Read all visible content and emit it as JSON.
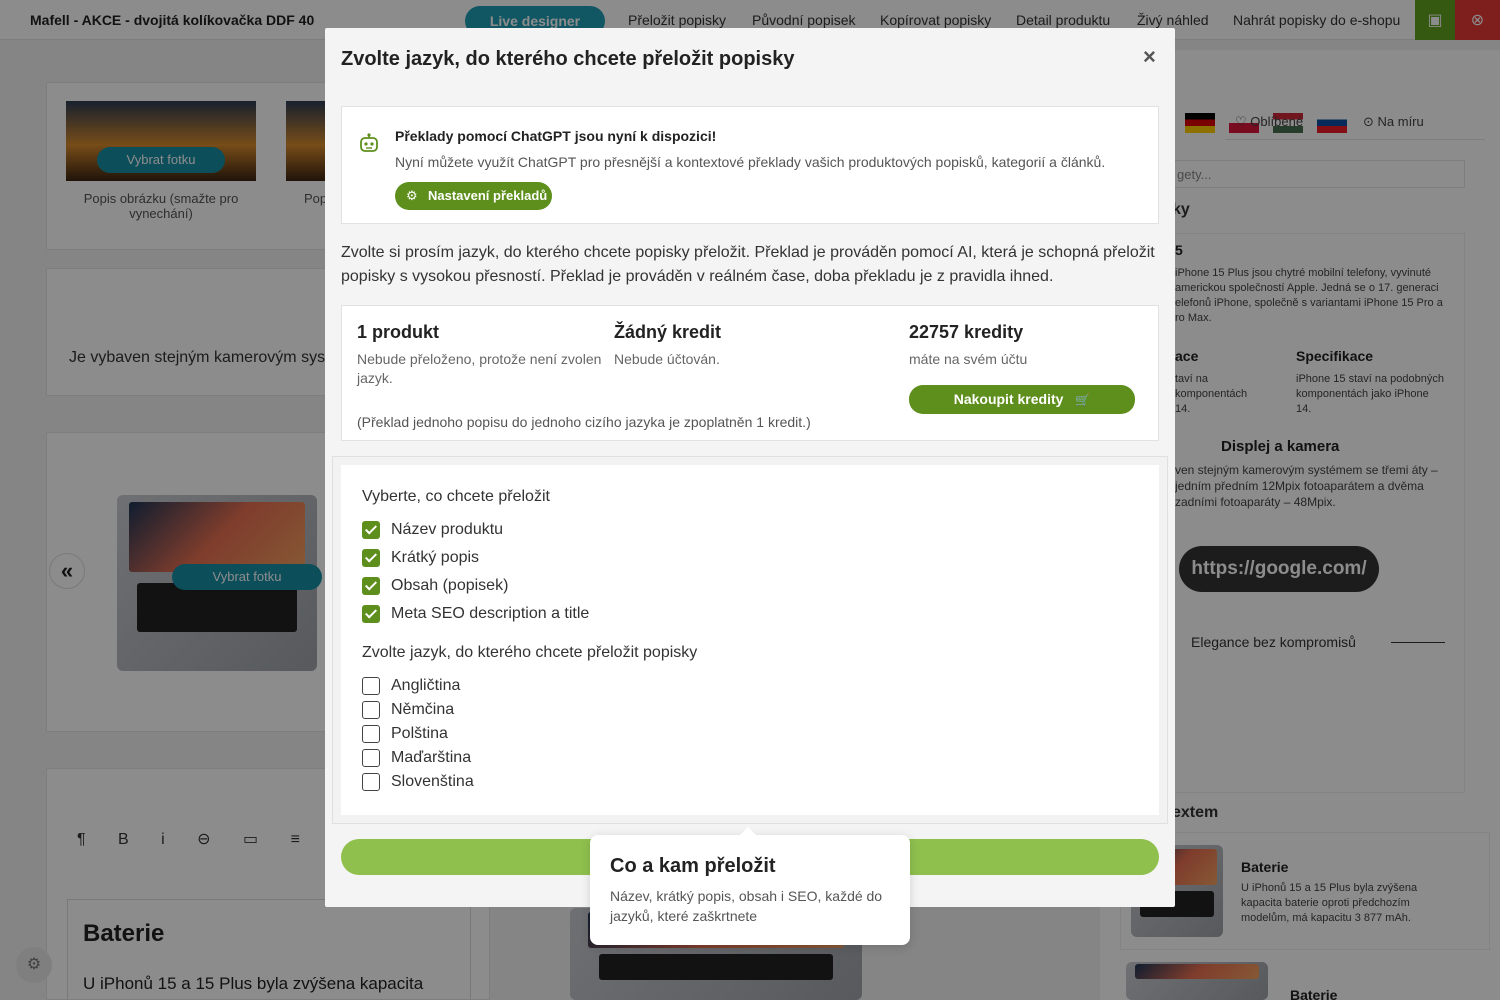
{
  "app": {
    "title": "Mafell - AKCE - dvojitá kolíkovačka DDF 40",
    "live_designer": "Live designer",
    "nav": [
      "Přeložit popisky",
      "Původní popisek",
      "Kopírovat popisky",
      "Detail produktu",
      "Živý náhled",
      "Nahrát popisky do e-shopu"
    ]
  },
  "background": {
    "pick_photo": "Vybrat fotku",
    "image_caption": "Popis obrázku (smažte pro vynechání)",
    "image_caption_cut": "Pop",
    "camera_text": "Je vybaven stejným kamerovým syste",
    "editor_heading": "Baterie",
    "editor_text": "U iPhonů 15 a 15 Plus byla zvýšena kapacita",
    "tabs": [
      "Oblíbené",
      "Na míru"
    ],
    "search_placeholder": "gety...",
    "section_short": "ky",
    "product_num": "5",
    "product_desc": "iPhone 15 Plus jsou chytré mobilní telefony, vyvinuté americkou společností Apple. Jedná se o 17. generaci elefonů iPhone, společně s variantami iPhone 15 Pro a ro Max.",
    "col1_h": "ace",
    "col1_p": "taví na komponentách 14.",
    "col2_h": "Specifikace",
    "col2_p": "iPhone 15 staví na podobných komponentách jako iPhone 14.",
    "display_h": "Displej a kamera",
    "display_p": "ven stejným kamerovým systémem se třemi áty – jedním předním 12Mpix fotoaparátem a dvěma zadními fotoaparáty – 48Mpix.",
    "link_btn": "https://google.com/",
    "elegance": "Elegance bez kompromisů",
    "with_text": "extem",
    "battery_h": "Baterie",
    "battery_p": "U iPhonů 15 a 15 Plus byla zvýšena kapacita baterie oproti předchozím modelům, má kapacitu 3 877 mAh.",
    "battery_h2": "Baterie"
  },
  "modal": {
    "title": "Zvolte jazyk, do kterého chcete přeložit popisky",
    "close": "×",
    "info": {
      "heading": "Překlady pomocí ChatGPT jsou nyní k dispozici!",
      "text": "Nyní můžete využít ChatGPT pro přesnější a kontextové překlady vašich produktových popisků, kategorií a článků.",
      "button": "Nastavení překladů"
    },
    "intro": "Zvolte si prosím jazyk, do kterého chcete popisky přeložit. Překlad je prováděn pomocí AI, která je schopná přeložit popisky s vysokou přesností. Překlad je prováděn v reálném čase, doba překladu je z pravidla ihned.",
    "stats": {
      "products_h": "1 produkt",
      "products_s": "Nebude přeloženo, protože není zvolen jazyk.",
      "credit_h": "Žádný kredit",
      "credit_s": "Nebude účtován.",
      "balance_h": "22757 kredity",
      "balance_s": "máte na svém účtu",
      "buy": "Nakoupit kredity",
      "note": "(Překlad jednoho popisu do jednoho cizího jazyka je zpoplatněn 1 kredit.)"
    },
    "what_heading": "Vyberte, co chcete přeložit",
    "what_items": [
      {
        "label": "Název produktu",
        "checked": true
      },
      {
        "label": "Krátký popis",
        "checked": true
      },
      {
        "label": "Obsah (popisek)",
        "checked": true
      },
      {
        "label": "Meta SEO description a title",
        "checked": true
      }
    ],
    "lang_heading": "Zvolte jazyk, do kterého chcete přeložit popisky",
    "lang_items": [
      {
        "label": "Angličtina",
        "checked": false
      },
      {
        "label": "Němčina",
        "checked": false
      },
      {
        "label": "Polština",
        "checked": false
      },
      {
        "label": "Maďarština",
        "checked": false
      },
      {
        "label": "Slovenština",
        "checked": false
      }
    ]
  },
  "tooltip": {
    "title": "Co a kam přeložit",
    "text": "Název, krátký popis, obsah i SEO, každé do jazyků, které zaškrtnete"
  },
  "colors": {
    "accent_green": "#5e8f1c",
    "submit_green": "#8fc04e",
    "teal": "#168fa4"
  }
}
